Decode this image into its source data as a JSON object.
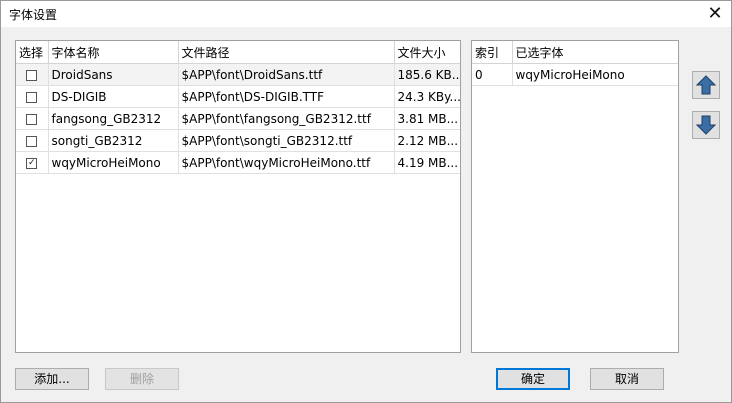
{
  "window": {
    "title": "字体设置",
    "close_icon": "close-icon"
  },
  "font_table": {
    "columns": [
      "选择",
      "字体名称",
      "文件路径",
      "文件大小"
    ],
    "rows": [
      {
        "checked": false,
        "name": "DroidSans",
        "path": "$APP\\font\\DroidSans.ttf",
        "size": "185.6 KB..."
      },
      {
        "checked": false,
        "name": "DS-DIGIB",
        "path": "$APP\\font\\DS-DIGIB.TTF",
        "size": "24.3 KBy..."
      },
      {
        "checked": false,
        "name": "fangsong_GB2312",
        "path": "$APP\\font\\fangsong_GB2312.ttf",
        "size": "3.81 MB..."
      },
      {
        "checked": false,
        "name": "songti_GB2312",
        "path": "$APP\\font\\songti_GB2312.ttf",
        "size": "2.12 MB..."
      },
      {
        "checked": true,
        "name": "wqyMicroHeiMono",
        "path": "$APP\\font\\wqyMicroHeiMono.ttf",
        "size": "4.19 MB..."
      }
    ]
  },
  "selected_table": {
    "columns": [
      "索引",
      "已选字体"
    ],
    "rows": [
      {
        "index": "0",
        "font": "wqyMicroHeiMono"
      }
    ]
  },
  "buttons": {
    "add": "添加...",
    "delete": "删除",
    "ok": "确定",
    "cancel": "取消"
  },
  "icons": {
    "move_up": "arrow-up-icon",
    "move_down": "arrow-down-icon"
  },
  "colors": {
    "arrow_fill": "#3a6ea5",
    "default_button_border": "#0078d7"
  }
}
